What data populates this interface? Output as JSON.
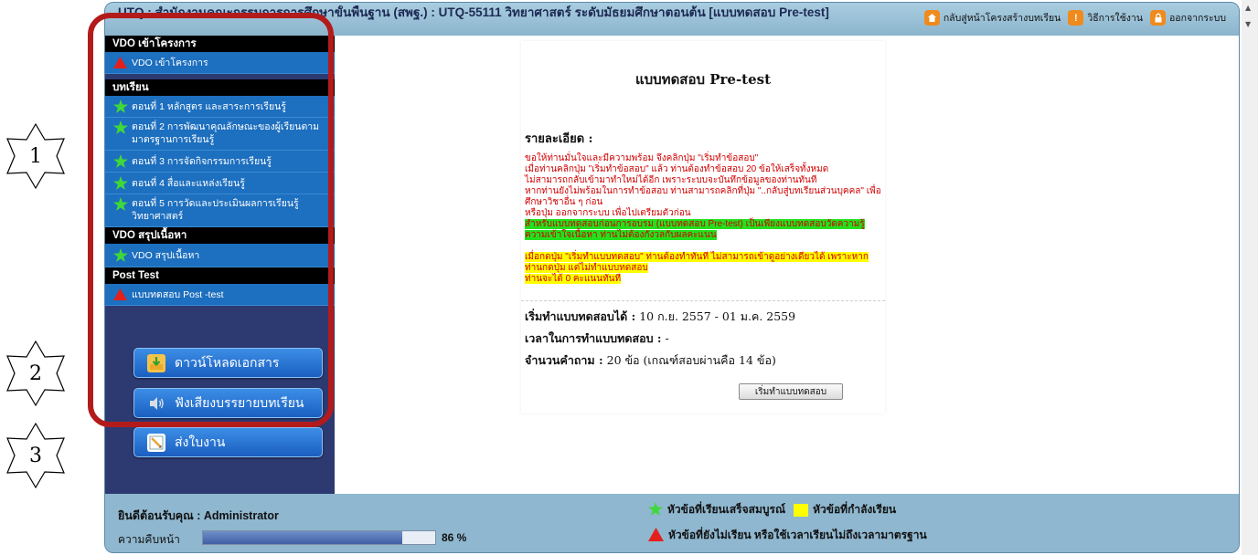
{
  "annotations": [
    "1",
    "2",
    "3"
  ],
  "header": {
    "title": "UTQ : สำนักงานคณะกรรมการการศึกษาขั้นพื้นฐาน (สพฐ.) : UTQ-55111 วิทยาศาสตร์ ระดับมัธยมศึกษาตอนต้น [แบบทดสอบ Pre-test]",
    "links": [
      {
        "label": "กลับสู่หน้าโครงสร้างบทเรียน",
        "icon": "home-icon",
        "color": "#f08a1c"
      },
      {
        "label": "วิธีการใช้งาน",
        "icon": "info-icon",
        "color": "#f08a1c"
      },
      {
        "label": "ออกจากระบบ",
        "icon": "lock-icon",
        "color": "#f08a1c"
      }
    ]
  },
  "sidebar": {
    "sections": [
      {
        "header": "VDO เข้าโครงการ",
        "items": [
          {
            "label": "VDO เข้าโครงการ",
            "status": "red-triangle"
          }
        ]
      },
      {
        "header": "บทเรียน",
        "items": [
          {
            "label": "ตอนที่ 1 หลักสูตร และสาระการเรียนรู้",
            "status": "green-star"
          },
          {
            "label": "ตอนที่ 2 การพัฒนาคุณลักษณะของผู้เรียนตามมาตรฐานการเรียนรู้",
            "status": "green-star"
          },
          {
            "label": "ตอนที่ 3 การจัดกิจกรรมการเรียนรู้",
            "status": "green-star"
          },
          {
            "label": "ตอนที่ 4 สื่อและแหล่งเรียนรู้",
            "status": "green-star"
          },
          {
            "label": "ตอนที่ 5 การวัดและประเมินผลการเรียนรู้วิทยาศาสตร์",
            "status": "green-star"
          }
        ]
      },
      {
        "header": "VDO สรุปเนื้อหา",
        "items": [
          {
            "label": "VDO สรุปเนื้อหา",
            "status": "green-star"
          }
        ]
      },
      {
        "header": "Post Test",
        "items": [
          {
            "label": "แบบทดสอบ Post -test",
            "status": "red-triangle"
          }
        ]
      }
    ],
    "buttons": [
      {
        "label": "ดาวน์โหลดเอกสาร",
        "icon": "download-icon"
      },
      {
        "label": "ฟังเสียงบรรยายบทเรียน",
        "icon": "speaker-icon"
      },
      {
        "label": "ส่งใบงาน",
        "icon": "send-icon"
      }
    ]
  },
  "test": {
    "title": "แบบทดสอบ Pre-test",
    "detail_heading": "รายละเอียด :",
    "instructions": [
      "ขอให้ท่านมั่นใจและมีความพร้อม จึงคลิกปุ่ม \"เริ่มทำข้อสอบ\"",
      "เมื่อท่านคลิกปุ่ม \"เริ่มทำข้อสอบ\" แล้ว ท่านต้องทำข้อสอบ 20 ข้อให้เสร็จทั้งหมด",
      "ไม่สามารถกลับเข้ามาทำใหม่ได้อีก เพราะระบบจะบันทึกข้อมูลของท่านทันที",
      "หากท่านยังไม่พร้อมในการทำข้อสอบ ท่านสามารถคลิกที่ปุ่ม \"..กลับสู่บทเรียนส่วนบุคคล\" เพื่อศึกษาวิชาอื่น ๆ ก่อน",
      "หรือปุ่ม ออกจากระบบ เพื่อไปเตรียมตัวก่อน"
    ],
    "green_note": "สำหรับแบบทดสอบก่อนการอบรม (แบบทดสอบ Pre-test) เป็นเพียงแบบทดสอบวัดความรู้ความเข้าใจเนื้อหา ท่านไม่ต้องกังวลกับผลคะแนน",
    "yellow_note": "เมื่อกดปุ่ม \"เริ่มทำแบบทดสอบ\" ท่านต้องทำทันที ไม่สามารถเข้าดูอย่างเดียวได้ เพราะหากท่านกดปุ่ม แต่ไม่ทำแบบทดสอบ",
    "yellow_note2": "ท่านจะได้ 0 คะแนนทันที",
    "start_label": "เริ่มทำแบบทดสอบได้ :",
    "start_value": "10 ก.ย. 2557 - 01 ม.ค. 2559",
    "time_label": "เวลาในการทำแบบทดสอบ :",
    "time_value": "-",
    "count_label": "จำนวนคำถาม :",
    "count_value": "20 ข้อ (เกณฑ์สอบผ่านคือ 14 ข้อ)",
    "start_button": "เริ่มทำแบบทดสอบ"
  },
  "footer": {
    "welcome_label": "ยินดีต้อนรับคุณ : Administrator",
    "progress_label": "ความคืบหน้า",
    "progress_value": 0.86,
    "progress_text": "86 %",
    "legend_completed": "หัวข้อที่เรียนเสร็จสมบูรณ์",
    "legend_current": "หัวข้อที่กำลังเรียน",
    "legend_incomplete": "หัวข้อที่ยังไม่เรียน หรือใช้เวลาเรียนไม่ถึงเวลามาตรฐาน"
  },
  "colors": {
    "frame": "#8fb7cf",
    "sidebar": "#2d3a72",
    "sidebar_item": "#1d6fbf",
    "highlight_red": "#b31b1b",
    "instruction_red": "#d10000",
    "green_highlight": "#22e11d",
    "yellow_highlight": "#ffff00"
  }
}
